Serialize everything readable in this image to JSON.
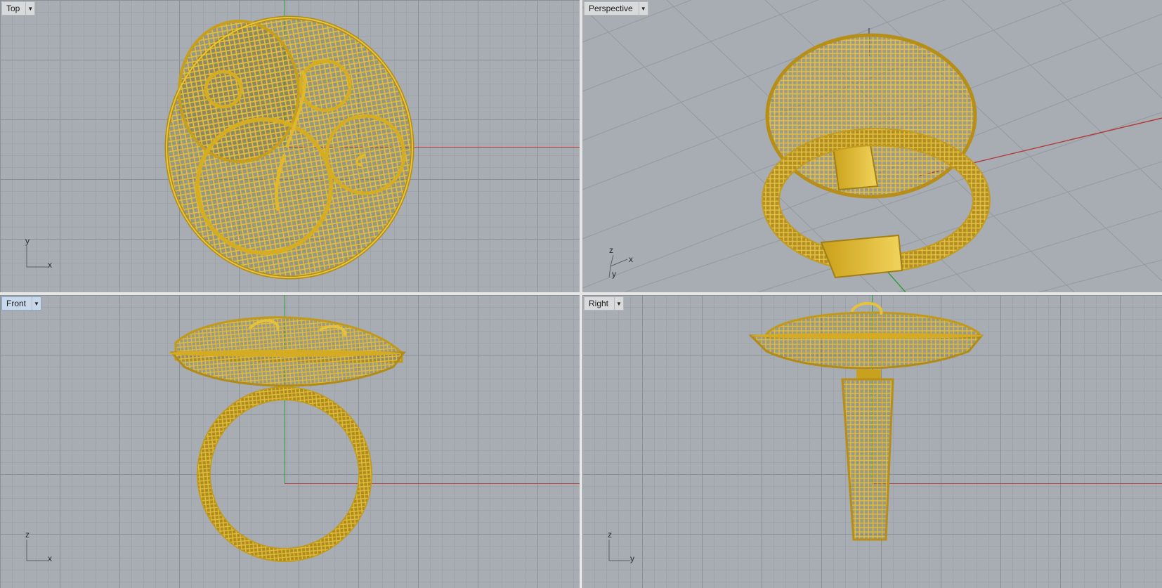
{
  "viewports": {
    "top": {
      "label": "Top",
      "triad": {
        "a": "y",
        "b": "x"
      }
    },
    "perspective": {
      "label": "Perspective",
      "triad": {
        "a": "z",
        "b": "x",
        "c": "y"
      }
    },
    "front": {
      "label": "Front",
      "triad": {
        "a": "z",
        "b": "x"
      }
    },
    "right": {
      "label": "Right",
      "triad": {
        "a": "z",
        "b": "y"
      }
    }
  },
  "active_viewport": "Front",
  "colors": {
    "background": "#a7adb2",
    "grid_minor": "#9ea4a9",
    "grid_major": "#8a9095",
    "x_axis": "#b23a3a",
    "y_axis": "#2f9a3d",
    "model": "#d4a820"
  },
  "icons": {
    "dropdown": "chevron-down-icon"
  }
}
